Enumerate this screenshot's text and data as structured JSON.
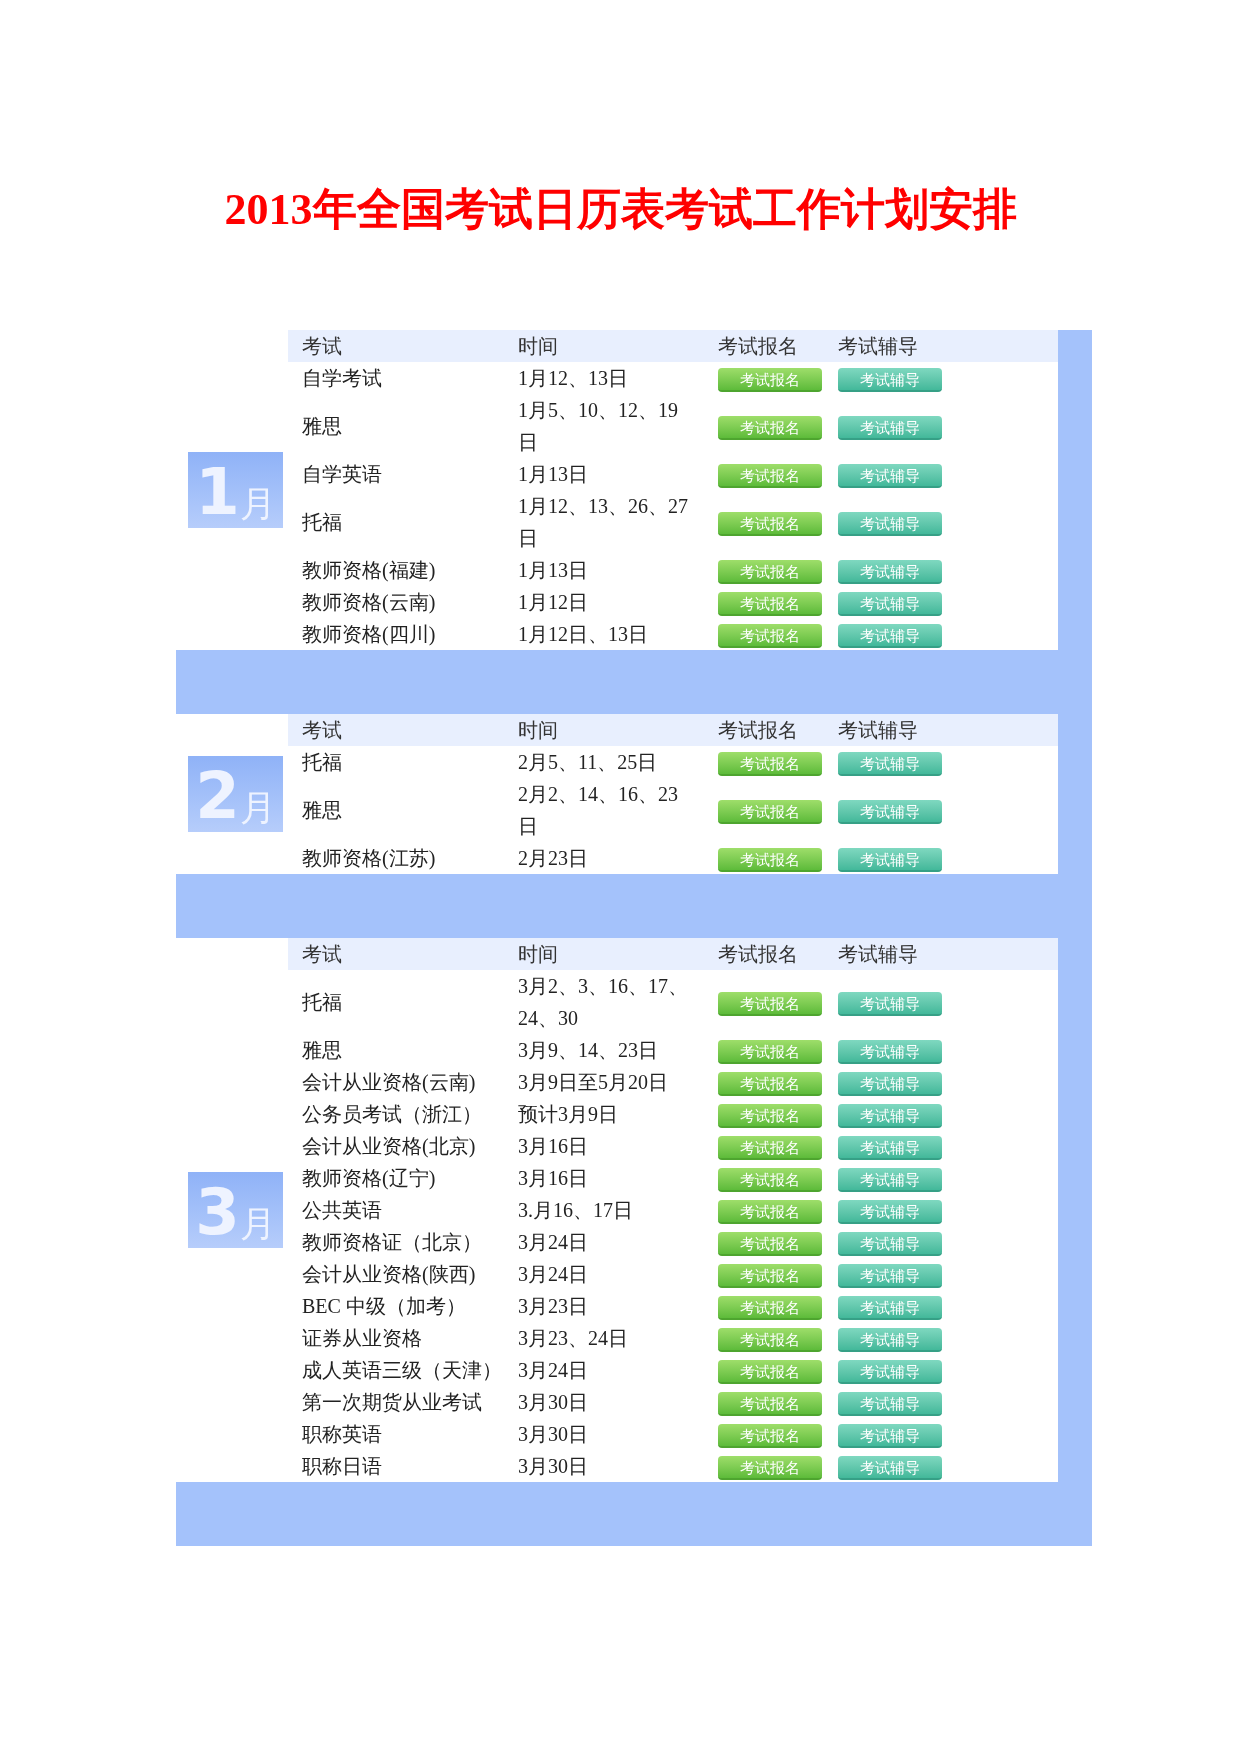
{
  "title": "2013年全国考试日历表考试工作计划安排",
  "months": [
    {
      "badge": {
        "number": "1",
        "unit": "月"
      },
      "columns": [
        "考试",
        "时间",
        "考试报名",
        "考试辅导"
      ],
      "rows": [
        {
          "exam": "自学考试",
          "time": "1月12、13日",
          "register": "考试报名",
          "tutoring": "考试辅导"
        },
        {
          "exam": "雅思",
          "time": "1月5、10、12、19日",
          "register": "考试报名",
          "tutoring": "考试辅导"
        },
        {
          "exam": "自学英语",
          "time": "1月13日",
          "register": "考试报名",
          "tutoring": "考试辅导"
        },
        {
          "exam": "托福",
          "time": "1月12、13、26、27日",
          "register": "考试报名",
          "tutoring": "考试辅导"
        },
        {
          "exam": "教师资格(福建)",
          "time": "1月13日",
          "register": "考试报名",
          "tutoring": "考试辅导"
        },
        {
          "exam": "教师资格(云南)",
          "time": "1月12日",
          "register": "考试报名",
          "tutoring": "考试辅导"
        },
        {
          "exam": "教师资格(四川)",
          "time": "1月12日、13日",
          "register": "考试报名",
          "tutoring": "考试辅导"
        }
      ]
    },
    {
      "badge": {
        "number": "2",
        "unit": "月"
      },
      "columns": [
        "考试",
        "时间",
        "考试报名",
        "考试辅导"
      ],
      "rows": [
        {
          "exam": "托福",
          "time": "2月5、11、25日",
          "register": "考试报名",
          "tutoring": "考试辅导"
        },
        {
          "exam": "雅思",
          "time": "2月2、14、16、23日",
          "register": "考试报名",
          "tutoring": "考试辅导"
        },
        {
          "exam": "教师资格(江苏)",
          "time": "2月23日",
          "register": "考试报名",
          "tutoring": "考试辅导"
        }
      ]
    },
    {
      "badge": {
        "number": "3",
        "unit": "月"
      },
      "columns": [
        "考试",
        "时间",
        "考试报名",
        "考试辅导"
      ],
      "rows": [
        {
          "exam": "托福",
          "time": "3月2、3、16、17、24、30",
          "register": "考试报名",
          "tutoring": "考试辅导"
        },
        {
          "exam": "雅思",
          "time": "3月9、14、23日",
          "register": "考试报名",
          "tutoring": "考试辅导"
        },
        {
          "exam": "会计从业资格(云南)",
          "time": "3月9日至5月20日",
          "register": "考试报名",
          "tutoring": "考试辅导"
        },
        {
          "exam": "公务员考试（浙江）",
          "time": "预计3月9日",
          "register": "考试报名",
          "tutoring": "考试辅导"
        },
        {
          "exam": "会计从业资格(北京)",
          "time": "3月16日",
          "register": "考试报名",
          "tutoring": "考试辅导"
        },
        {
          "exam": "教师资格(辽宁)",
          "time": "3月16日",
          "register": "考试报名",
          "tutoring": "考试辅导"
        },
        {
          "exam": "公共英语",
          "time": "3.月16、17日",
          "register": "考试报名",
          "tutoring": "考试辅导"
        },
        {
          "exam": "教师资格证（北京）",
          "time": "3月24日",
          "register": "考试报名",
          "tutoring": "考试辅导"
        },
        {
          "exam": "会计从业资格(陕西)",
          "time": "3月24日",
          "register": "考试报名",
          "tutoring": "考试辅导"
        },
        {
          "exam": "BEC 中级（加考）",
          "time": "3月23日",
          "register": "考试报名",
          "tutoring": "考试辅导"
        },
        {
          "exam": "证券从业资格",
          "time": "3月23、24日",
          "register": "考试报名",
          "tutoring": "考试辅导"
        },
        {
          "exam": "成人英语三级（天津）",
          "time": "3月24日",
          "register": "考试报名",
          "tutoring": "考试辅导"
        },
        {
          "exam": "第一次期货从业考试",
          "time": "3月30日",
          "register": "考试报名",
          "tutoring": "考试辅导"
        },
        {
          "exam": "职称英语",
          "time": "3月30日",
          "register": "考试报名",
          "tutoring": "考试辅导"
        },
        {
          "exam": "职称日语",
          "time": "3月30日",
          "register": "考试报名",
          "tutoring": "考试辅导"
        }
      ]
    }
  ]
}
